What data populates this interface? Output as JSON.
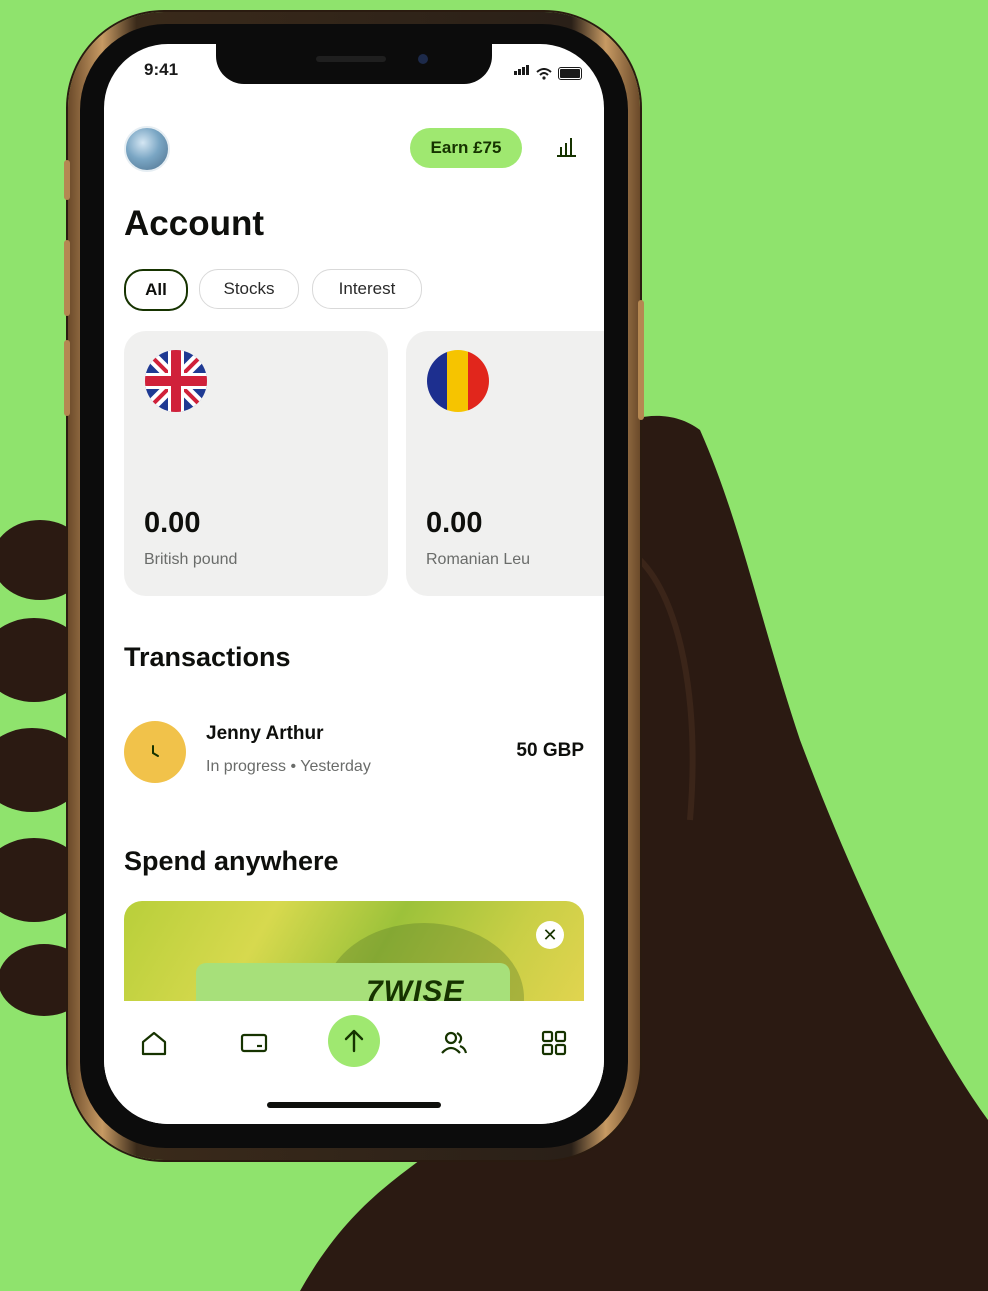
{
  "colors": {
    "background": "#8fe36d",
    "accent_green": "#9fe870",
    "dark_green": "#163300",
    "pending_yellow": "#f1c24a"
  },
  "status_bar": {
    "time": "9:41",
    "icons": [
      "signal-icon",
      "wifi-icon",
      "battery-icon"
    ]
  },
  "header": {
    "avatar": "avatar",
    "earn_label": "Earn £75",
    "insights_icon": "bar-chart-icon"
  },
  "page": {
    "title": "Account"
  },
  "filters": [
    {
      "label": "All",
      "selected": true
    },
    {
      "label": "Stocks",
      "selected": false
    },
    {
      "label": "Interest",
      "selected": false
    }
  ],
  "balances": [
    {
      "flag": "uk-flag-icon",
      "amount": "0.00",
      "currency": "British pound"
    },
    {
      "flag": "romania-flag-icon",
      "amount": "0.00",
      "currency": "Romanian Leu"
    }
  ],
  "transactions": {
    "title": "Transactions",
    "items": [
      {
        "icon": "clock-icon",
        "name": "Jenny Arthur",
        "status": "In progress • Yesterday",
        "amount": "50 GBP"
      }
    ]
  },
  "promo": {
    "title": "Spend anywhere",
    "card_text": "7WISE",
    "close_icon": "close-icon"
  },
  "tab_bar": [
    "home-icon",
    "card-icon",
    "send-icon",
    "recipients-icon",
    "apps-grid-icon"
  ]
}
